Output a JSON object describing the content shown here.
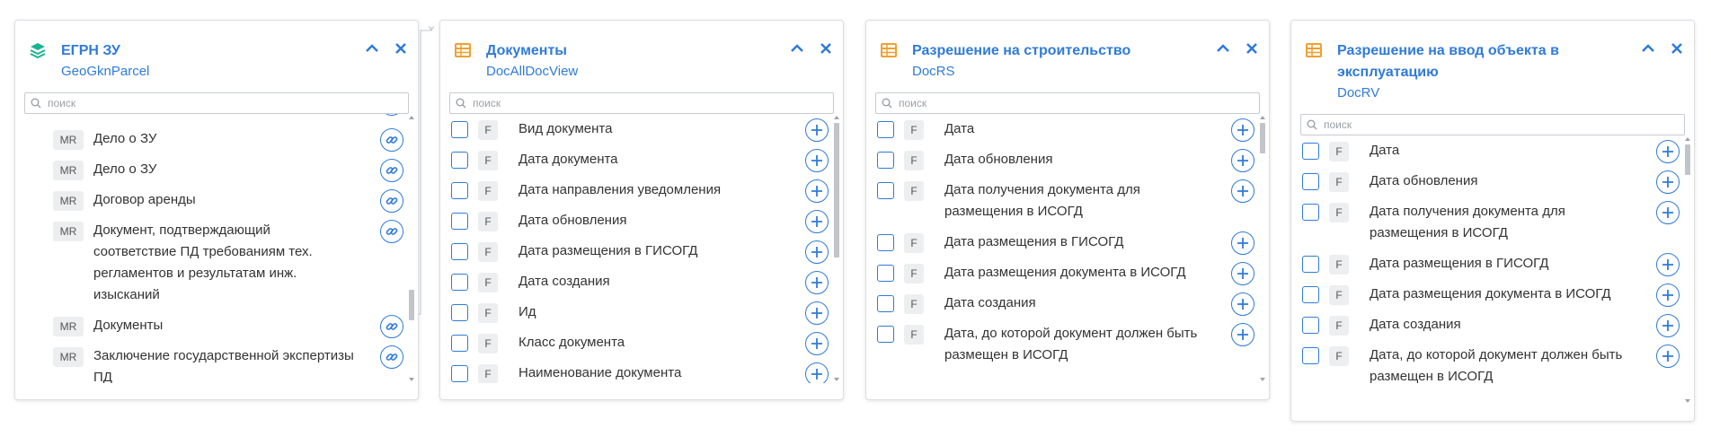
{
  "search_placeholder": "поиск",
  "panels": [
    {
      "title": "ЕГРН ЗУ",
      "subtitle": "GeoGknParcel",
      "icon": "layers-icon",
      "rows": [
        {
          "tag": "MR",
          "label": "Дело о ЗУ"
        },
        {
          "tag": "MR",
          "label": "Дело о ЗУ"
        },
        {
          "tag": "MR",
          "label": "Договор аренды"
        },
        {
          "tag": "MR",
          "label": "Документ, подтверждающий соответствие ПД требованиям тех. регламентов и результатам инж. изысканий"
        },
        {
          "tag": "MR",
          "label": "Документы"
        },
        {
          "tag": "MR",
          "label": "Заключение государственной экспертизы ПД"
        }
      ]
    },
    {
      "title": "Документы",
      "subtitle": "DocAllDocView",
      "icon": "table-icon",
      "rows": [
        {
          "tag": "F",
          "label": "Вид документа"
        },
        {
          "tag": "F",
          "label": "Дата документа"
        },
        {
          "tag": "F",
          "label": "Дата направления уведомления"
        },
        {
          "tag": "F",
          "label": "Дата обновления"
        },
        {
          "tag": "F",
          "label": "Дата размещения в ГИСОГД"
        },
        {
          "tag": "F",
          "label": "Дата создания"
        },
        {
          "tag": "F",
          "label": "Ид"
        },
        {
          "tag": "F",
          "label": "Класс документа"
        },
        {
          "tag": "F",
          "label": "Наименование документа"
        }
      ]
    },
    {
      "title": "Разрешение на строительство",
      "subtitle": "DocRS",
      "icon": "table-icon",
      "rows": [
        {
          "tag": "F",
          "label": "Дата"
        },
        {
          "tag": "F",
          "label": "Дата обновления"
        },
        {
          "tag": "F",
          "label": "Дата получения документа для размещения в ИСОГД"
        },
        {
          "tag": "F",
          "label": "Дата размещения в ГИСОГД"
        },
        {
          "tag": "F",
          "label": "Дата размещения документа в ИСОГД"
        },
        {
          "tag": "F",
          "label": "Дата создания"
        },
        {
          "tag": "F",
          "label": "Дата, до которой документ должен быть размещен в ИСОГД"
        }
      ]
    },
    {
      "title": "Разрешение на ввод объекта в эксплуатацию",
      "subtitle": "DocRV",
      "icon": "table-icon",
      "rows": [
        {
          "tag": "F",
          "label": "Дата"
        },
        {
          "tag": "F",
          "label": "Дата обновления"
        },
        {
          "tag": "F",
          "label": "Дата получения документа для размещения в ИСОГД"
        },
        {
          "tag": "F",
          "label": "Дата размещения в ГИСОГД"
        },
        {
          "tag": "F",
          "label": "Дата размещения документа в ИСОГД"
        },
        {
          "tag": "F",
          "label": "Дата создания"
        },
        {
          "tag": "F",
          "label": "Дата, до которой документ должен быть размещен в ИСОГД"
        }
      ]
    }
  ],
  "colors": {
    "accent": "#2f7bd9",
    "layers": "#1ab394",
    "table": "#f0a030"
  }
}
